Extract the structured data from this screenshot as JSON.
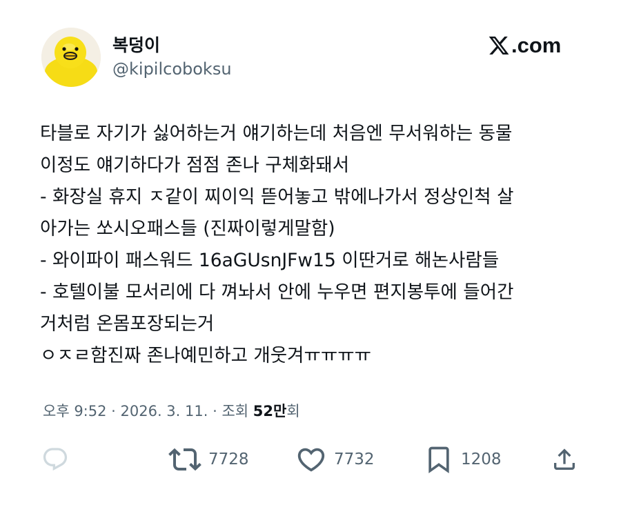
{
  "author": {
    "display_name": "복덩이",
    "handle": "@kipilcoboksu",
    "avatar_icon": "yellow-duck-avatar"
  },
  "brand": {
    "label": ".com",
    "icon": "x-logo-icon"
  },
  "tweet": {
    "lines": [
      "타블로 자기가 싫어하는거 얘기하는데 처음엔 무서워하는 동물",
      "이정도 얘기하다가 점점 존나 구체화돼서",
      "- 화장실 휴지 ㅈ같이 찌이익 뜯어놓고 밖에나가서 정상인척 살",
      "아가는 쏘시오패스들 (진짜이렇게말함)",
      "- 와이파이 패스워드 16aGUsnJFw15 이딴거로 해논사람들",
      "- 호텔이불 모서리에 다 껴놔서 안에 누우면 편지봉투에 들어간",
      "거처럼 온몸포장되는거",
      "ㅇㅈㄹ함진짜 존나예민하고 개웃겨ㅠㅠㅠㅠ"
    ]
  },
  "meta": {
    "time": "오후 9:52",
    "separator": " · ",
    "date": "2026. 3. 11.",
    "views_label": "조회 ",
    "views_count": "52만",
    "views_suffix": "회"
  },
  "actions": {
    "reply": {
      "icon": "reply-icon"
    },
    "retweet": {
      "icon": "retweet-icon",
      "count": "7728"
    },
    "like": {
      "icon": "heart-icon",
      "count": "7732"
    },
    "bookmark": {
      "icon": "bookmark-icon",
      "count": "1208"
    },
    "share": {
      "icon": "share-icon"
    }
  },
  "colors": {
    "text_primary": "#0f1419",
    "text_secondary": "#536471",
    "reply_icon": "#cfd9de",
    "avatar_duck": "#f8df1a",
    "background": "#ffffff"
  }
}
